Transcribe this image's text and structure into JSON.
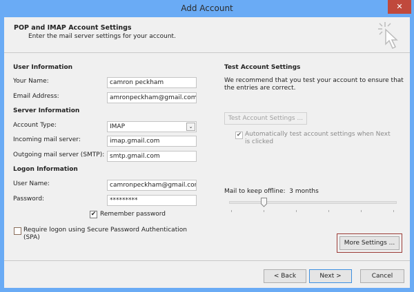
{
  "window": {
    "title": "Add Account",
    "close": "✕"
  },
  "header": {
    "title": "POP and IMAP Account Settings",
    "subtitle": "Enter the mail server settings for your account."
  },
  "user_info": {
    "heading": "User Information",
    "name_label": "Your Name:",
    "name_value": "camron peckham",
    "email_label": "Email Address:",
    "email_value": "amronpeckham@gmail.com"
  },
  "server_info": {
    "heading": "Server Information",
    "type_label": "Account Type:",
    "type_value": "IMAP",
    "incoming_label": "Incoming mail server:",
    "incoming_value": "imap.gmail.com",
    "outgoing_label": "Outgoing mail server (SMTP):",
    "outgoing_value": "smtp.gmail.com"
  },
  "logon_info": {
    "heading": "Logon Information",
    "user_label": "User Name:",
    "user_value": "camronpeckham@gmail.com",
    "password_label": "Password:",
    "password_value": "*********",
    "remember_label": "Remember password",
    "remember_checked": true,
    "spa_label": "Require logon using Secure Password Authentication (SPA)",
    "spa_checked": false
  },
  "test": {
    "heading": "Test Account Settings",
    "description": "We recommend that you test your account to ensure that the entries are correct.",
    "button": "Test Account Settings ...",
    "auto_label": "Automatically test account settings when Next is clicked",
    "auto_checked": true
  },
  "offline": {
    "label": "Mail to keep offline:",
    "value": "3 months",
    "slider_index": 1,
    "slider_steps": 6
  },
  "buttons": {
    "more_settings": "More Settings ...",
    "back": "< Back",
    "next": "Next >",
    "cancel": "Cancel"
  },
  "colors": {
    "accent": "#6aabf5",
    "highlight": "#9b3a35"
  }
}
